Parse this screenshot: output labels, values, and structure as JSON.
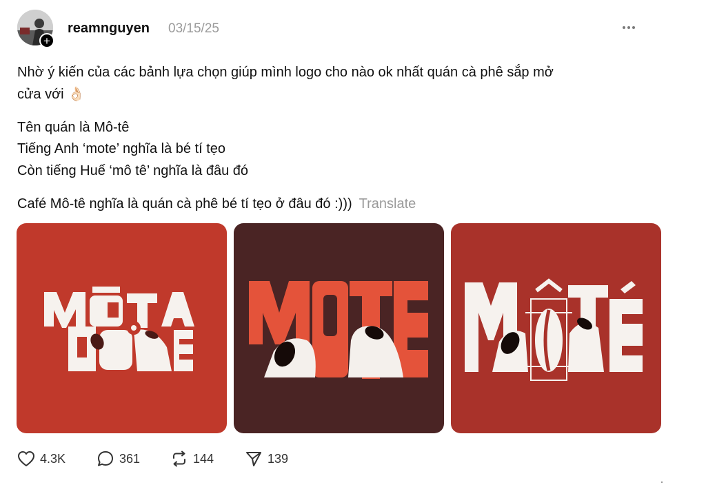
{
  "post": {
    "username": "reamnguyen",
    "timestamp": "03/15/25",
    "text_lines": [
      "Nhờ ý kiến của các bảnh lựa chọn giúp mình logo cho nào ok nhất quán cà phê sắp mở",
      "cửa với 👌🏻",
      "Tên quán là Mô-tê",
      "Tiếng Anh ‘mote’ nghĩa là bé tí tẹo",
      "Còn tiếng Huế ‘mô tê’ nghĩa là đâu đó",
      "Café Mô-tê nghĩa là quán cà phê bé tí tẹo ở đâu đó :)))"
    ],
    "translate_label": "Translate",
    "images": [
      {
        "logo_text": "MÔTÊ",
        "background": "#C0392B"
      },
      {
        "logo_text": "MOTE",
        "background": "#4A2424"
      },
      {
        "logo_text": "MÔTÉ",
        "background": "#A9322A"
      }
    ]
  },
  "actions": {
    "likes": "4.3K",
    "comments": "361",
    "reposts": "144",
    "shares": "139"
  },
  "colors": {
    "red": "#C0392B",
    "dark_brown": "#4A2424",
    "orange_red": "#E4533A",
    "muted_text": "#9A9A9A"
  }
}
